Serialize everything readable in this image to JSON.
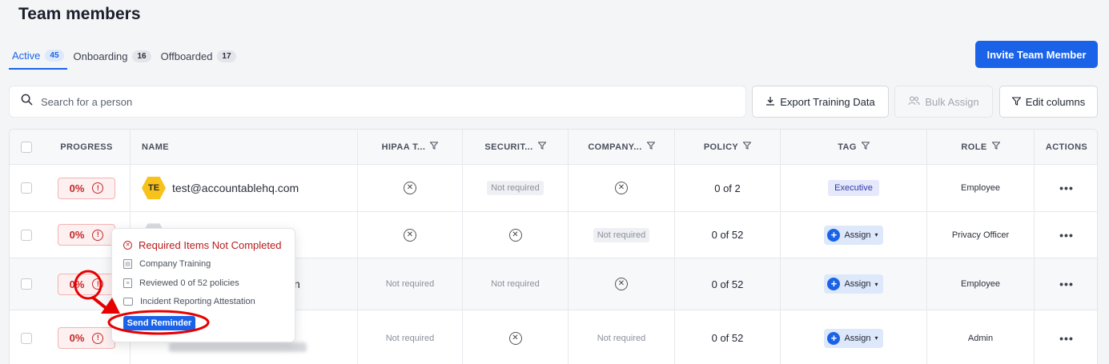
{
  "page_title": "Team members",
  "tabs": [
    {
      "label": "Active",
      "count": "45",
      "active": true
    },
    {
      "label": "Onboarding",
      "count": "16",
      "active": false
    },
    {
      "label": "Offboarded",
      "count": "17",
      "active": false
    }
  ],
  "invite_button": "Invite Team Member",
  "search": {
    "placeholder": "Search for a person",
    "icon": "search-icon"
  },
  "toolbar": {
    "export": "Export Training Data",
    "bulk_assign": "Bulk Assign",
    "edit_columns": "Edit columns"
  },
  "columns": {
    "progress": "PROGRESS",
    "name": "NAME",
    "hipaa": "HIPAA T...",
    "security": "SECURIT...",
    "company": "COMPANY...",
    "policy": "POLICY",
    "tag": "TAG",
    "role": "ROLE",
    "actions": "ACTIONS"
  },
  "rows": [
    {
      "progress": "0%",
      "initials": "TE",
      "name": "test@accountablehq.com",
      "hipaa": "x",
      "security": "Not required",
      "company": "x",
      "policy": "0 of 2",
      "tag": "Executive",
      "role": "Employee"
    },
    {
      "progress": "0%",
      "initials": "",
      "name": "",
      "hipaa": "x",
      "security": "x",
      "company": "Not required",
      "policy": "0 of 52",
      "tag": "Assign",
      "role": "Privacy Officer"
    },
    {
      "progress": "0%",
      "initials": "",
      "name": "n",
      "hipaa": "Not required",
      "security": "Not required",
      "company": "x",
      "policy": "0 of 52",
      "tag": "Assign",
      "role": "Employee"
    },
    {
      "progress": "0%",
      "initials": "",
      "name": "",
      "hipaa": "Not required",
      "security": "x",
      "company": "Not required",
      "policy": "0 of 52",
      "tag": "Assign",
      "role": "Admin"
    }
  ],
  "actions_glyph": "•••",
  "popover": {
    "title": "Required Items Not Completed",
    "items": [
      "Company Training",
      "Reviewed 0 of 52 policies",
      "Incident Reporting Attestation"
    ],
    "button": "Send Reminder"
  },
  "colors": {
    "accent": "#1a63e8",
    "danger": "#c62828",
    "annotation": "#e60000"
  }
}
